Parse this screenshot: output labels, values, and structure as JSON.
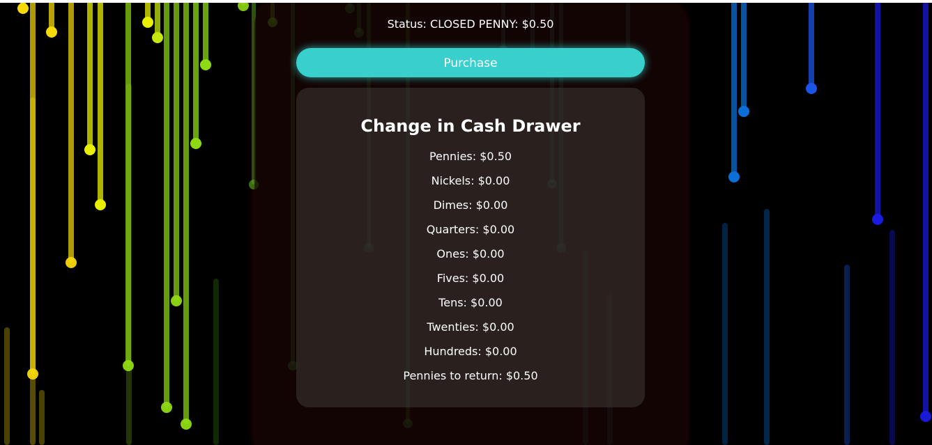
{
  "status": {
    "text": "Status: CLOSED PENNY: $0.50"
  },
  "purchase_button": {
    "label": "Purchase"
  },
  "drawer": {
    "title": "Change in Cash Drawer",
    "items": [
      "Pennies: $0.50",
      "Nickels: $0.00",
      "Dimes: $0.00",
      "Quarters: $0.00",
      "Ones: $0.00",
      "Fives: $0.00",
      "Tens: $0.00",
      "Twenties: $0.00",
      "Hundreds: $0.00",
      "Pennies to return: $0.50"
    ]
  },
  "colors": {
    "page_background": "#000000",
    "button_background": "#38cfcc",
    "text": "#ffffff",
    "panel_background": "rgba(62, 58, 55, 0.55)",
    "rain_palette": [
      "#f5d90a",
      "#e8f000",
      "#c6e80f",
      "#8fd914",
      "#5cc41f",
      "#2d8f3a",
      "#2a8a7a",
      "#0a6fd6",
      "#1a55e8",
      "#1a1ae0",
      "#7a1a10"
    ]
  }
}
